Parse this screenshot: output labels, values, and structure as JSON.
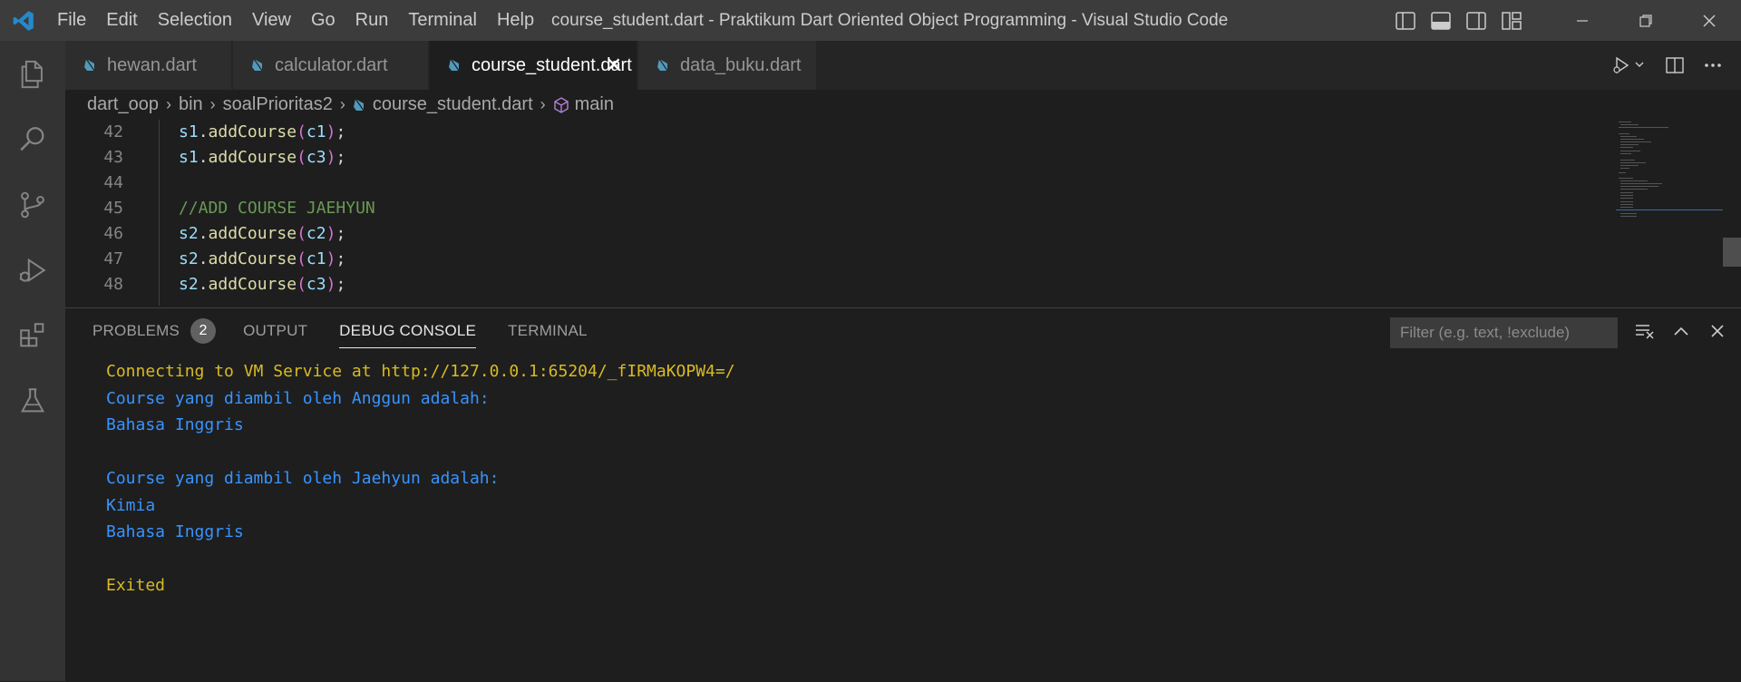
{
  "titlebar": {
    "menu": [
      "File",
      "Edit",
      "Selection",
      "View",
      "Go",
      "Run",
      "Terminal",
      "Help"
    ],
    "window_title": "course_student.dart - Praktikum Dart Oriented Object Programming - Visual Studio Code"
  },
  "tabs": [
    {
      "label": "hewan.dart",
      "active": false
    },
    {
      "label": "calculator.dart",
      "active": false
    },
    {
      "label": "course_student.dart",
      "active": true
    },
    {
      "label": "data_buku.dart",
      "active": false
    }
  ],
  "breadcrumb": [
    "dart_oop",
    "bin",
    "soalPrioritas2",
    "course_student.dart",
    "main"
  ],
  "editor": {
    "lines": [
      {
        "num": "42",
        "text": "s1.addCourse(c1);"
      },
      {
        "num": "43",
        "text": "s1.addCourse(c3);"
      },
      {
        "num": "44",
        "text": ""
      },
      {
        "num": "45",
        "text": "//ADD COURSE JAEHYUN"
      },
      {
        "num": "46",
        "text": "s2.addCourse(c2);"
      },
      {
        "num": "47",
        "text": "s2.addCourse(c1);"
      },
      {
        "num": "48",
        "text": "s2.addCourse(c3);"
      }
    ]
  },
  "panel": {
    "tabs": [
      "PROBLEMS",
      "OUTPUT",
      "DEBUG CONSOLE",
      "TERMINAL"
    ],
    "problems_count": "2",
    "active_tab": "DEBUG CONSOLE",
    "filter_placeholder": "Filter (e.g. text, !exclude)",
    "console_lines": [
      {
        "text": "Connecting to VM Service at http://127.0.0.1:65204/_fIRMaKOPW4=/",
        "color": "yellow"
      },
      {
        "text": "Course yang diambil oleh Anggun adalah:",
        "color": "blue"
      },
      {
        "text": "Bahasa Inggris",
        "color": "blue"
      },
      {
        "text": "",
        "color": "blue"
      },
      {
        "text": "Course yang diambil oleh Jaehyun adalah:",
        "color": "blue"
      },
      {
        "text": "Kimia",
        "color": "blue"
      },
      {
        "text": "Bahasa Inggris",
        "color": "blue"
      },
      {
        "text": "",
        "color": "blue"
      },
      {
        "text": "Exited",
        "color": "yellow"
      }
    ]
  },
  "colors": {
    "accent_blue": "#3794ff",
    "console_yellow": "#d7ba25",
    "vscode_logo": "#2489ca",
    "dart_icon": "#519aba"
  },
  "icons": {
    "activity": [
      "explorer-icon",
      "search-icon",
      "source-control-icon",
      "run-debug-icon",
      "extensions-icon",
      "testing-icon"
    ]
  }
}
